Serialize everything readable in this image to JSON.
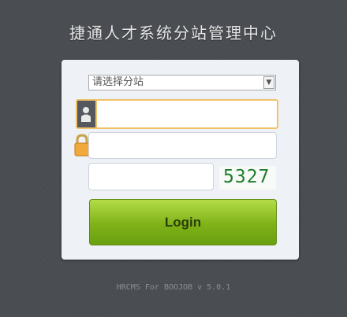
{
  "header": {
    "title": "捷通人才系统分站管理中心"
  },
  "form": {
    "site_select": {
      "value": "请选择分站"
    },
    "username": {
      "value": ""
    },
    "password": {
      "value": ""
    },
    "captcha": {
      "value": "",
      "image_text": "5327"
    },
    "login_label": "Login"
  },
  "footer": {
    "text": "HRCMS For BOOJOB v 5.0.1"
  },
  "colors": {
    "accent": "#f0c36a",
    "button": "#7fb218",
    "background": "#4a4d52"
  },
  "icons": {
    "username": "user-icon",
    "password": "lock-icon",
    "dropdown": "chevron-down-icon"
  }
}
